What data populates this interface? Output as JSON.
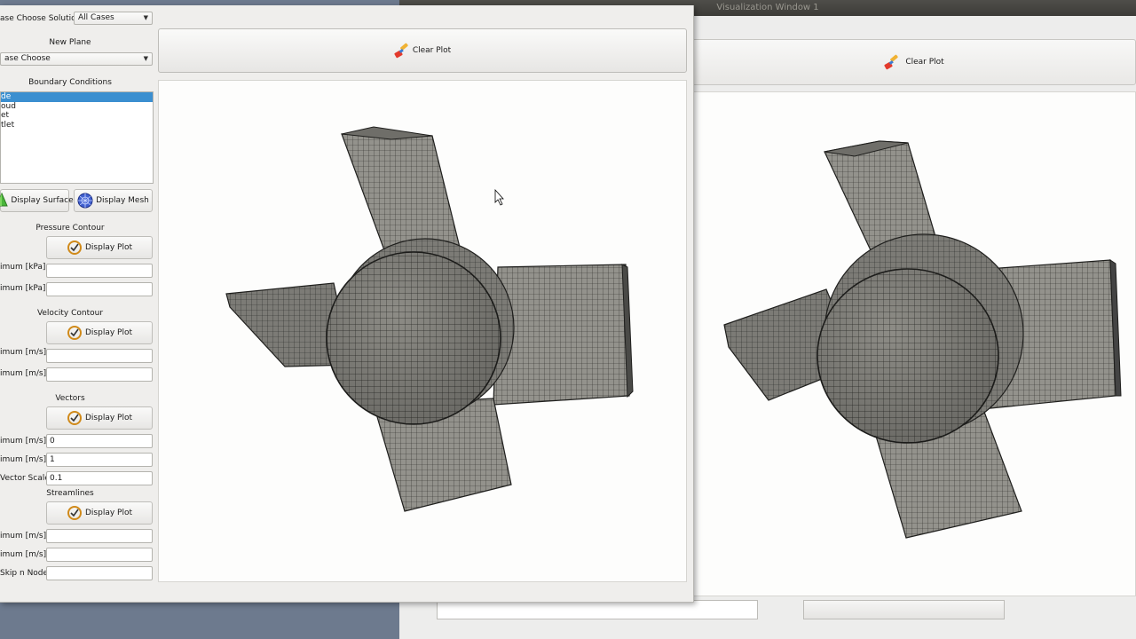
{
  "back_window": {
    "title": "Visualization Window 1",
    "clear_plot_label": "Clear Plot"
  },
  "front_window": {
    "choose_solution": {
      "label": "ase Choose Solution",
      "value": "All Cases"
    },
    "new_plane": {
      "label": "New Plane",
      "value": "ase Choose"
    },
    "boundary_conditions": {
      "label": "Boundary Conditions",
      "items": [
        "de",
        "oud",
        "et",
        "tlet"
      ],
      "selected_index": 0
    },
    "display_surface_label": "Display Surface",
    "display_mesh_label": "Display Mesh",
    "pressure_contour": {
      "title": "Pressure Contour",
      "button": "Display Plot",
      "min_label": "imum [kPa]",
      "max_label": "imum [kPa]",
      "min_value": "",
      "max_value": ""
    },
    "velocity_contour": {
      "title": "Velocity Contour",
      "button": "Display Plot",
      "min_label": "imum [m/s]",
      "max_label": "imum [m/s]",
      "min_value": "",
      "max_value": ""
    },
    "vectors": {
      "title": "Vectors",
      "button": "Display Plot",
      "min_label": "imum [m/s]",
      "max_label": "imum [m/s]",
      "scale_label": "Vector Scale",
      "min_value": "0",
      "max_value": "1",
      "scale_value": "0.1"
    },
    "streamlines": {
      "title": "Streamlines",
      "button": "Display Plot",
      "min_label": "imum [m/s]",
      "max_label": "imum [m/s]",
      "skip_label": "Skip n Node",
      "min_value": "",
      "max_value": "",
      "skip_value": ""
    },
    "clear_plot_label": "Clear Plot"
  },
  "colors": {
    "mesh_fill": "#8d8c86",
    "mesh_line": "#2b2b28",
    "selection": "#3b8fd0"
  },
  "icons": [
    "paint-brush-icon",
    "surface-icon",
    "mesh-globe-icon",
    "plot-refresh-icon",
    "mouse-cursor-icon"
  ]
}
